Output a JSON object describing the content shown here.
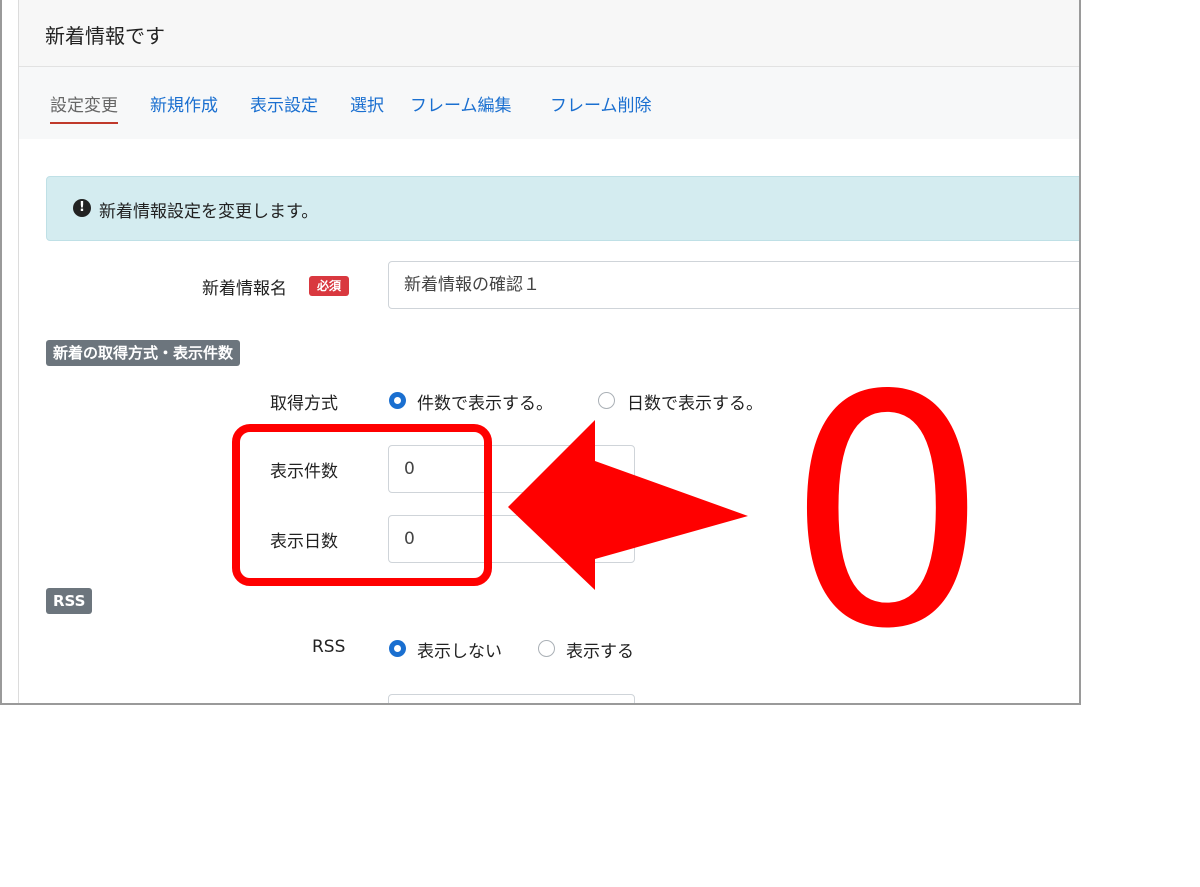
{
  "window": {
    "title": "新着情報です"
  },
  "tabs": [
    {
      "label": "設定変更",
      "active": true
    },
    {
      "label": "新規作成"
    },
    {
      "label": "表示設定"
    },
    {
      "label": "選択"
    },
    {
      "label": "フレーム編集"
    },
    {
      "label": "フレーム削除"
    }
  ],
  "alert": {
    "icon": "exclamation-circle-icon",
    "text": "新着情報設定を変更します。"
  },
  "form": {
    "name_label": "新着情報名",
    "required_badge": "必須",
    "name_value": "新着情報の確認１",
    "section1_badge": "新着の取得方式・表示件数",
    "method_label": "取得方式",
    "method_options": [
      {
        "label": "件数で表示する。",
        "selected": true
      },
      {
        "label": "日数で表示する。",
        "selected": false
      }
    ],
    "count_label": "表示件数",
    "count_value": "0",
    "days_label": "表示日数",
    "days_value": "0",
    "section2_badge": "RSS",
    "rss_label": "RSS",
    "rss_options": [
      {
        "label": "表示しない",
        "selected": true
      },
      {
        "label": "表示する",
        "selected": false
      }
    ]
  },
  "annotation": {
    "text": "0",
    "color": "#ff0000"
  }
}
